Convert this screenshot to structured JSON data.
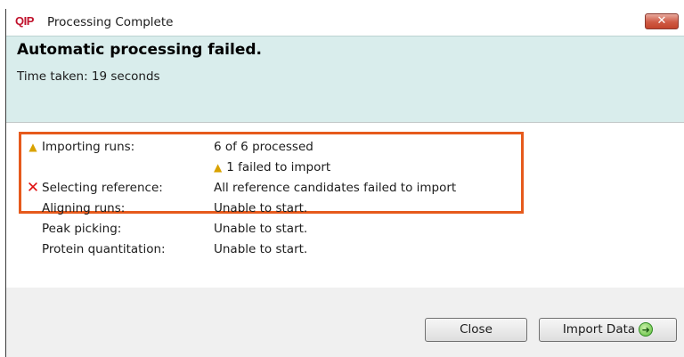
{
  "window": {
    "logo_text": "QIP",
    "title": "Processing Complete",
    "close_glyph": "✕"
  },
  "header": {
    "headline": "Automatic processing failed.",
    "time_taken": "Time taken: 19 seconds"
  },
  "steps": [
    {
      "label": "Importing runs:",
      "status": "6 of 6 processed",
      "icon": "warning-icon"
    },
    {
      "label": "",
      "status": "1 failed to import",
      "icon": "warning-icon"
    },
    {
      "label": "Selecting reference:",
      "status": "All reference candidates failed to import",
      "icon": "error-x-icon"
    },
    {
      "label": "Aligning runs:",
      "status": "Unable to start.",
      "icon": ""
    },
    {
      "label": "Peak picking:",
      "status": "Unable to start.",
      "icon": ""
    },
    {
      "label": "Protein quantitation:",
      "status": "Unable to start.",
      "icon": ""
    }
  ],
  "buttons": {
    "close_label": "Close",
    "import_label": "Import Data",
    "import_icon": "green-arrow-right-icon"
  },
  "colors": {
    "highlight_border": "#e65a1c",
    "header_band": "#d9edec",
    "warning": "#d9a200",
    "error": "#e01010",
    "logo": "#c0112b"
  }
}
